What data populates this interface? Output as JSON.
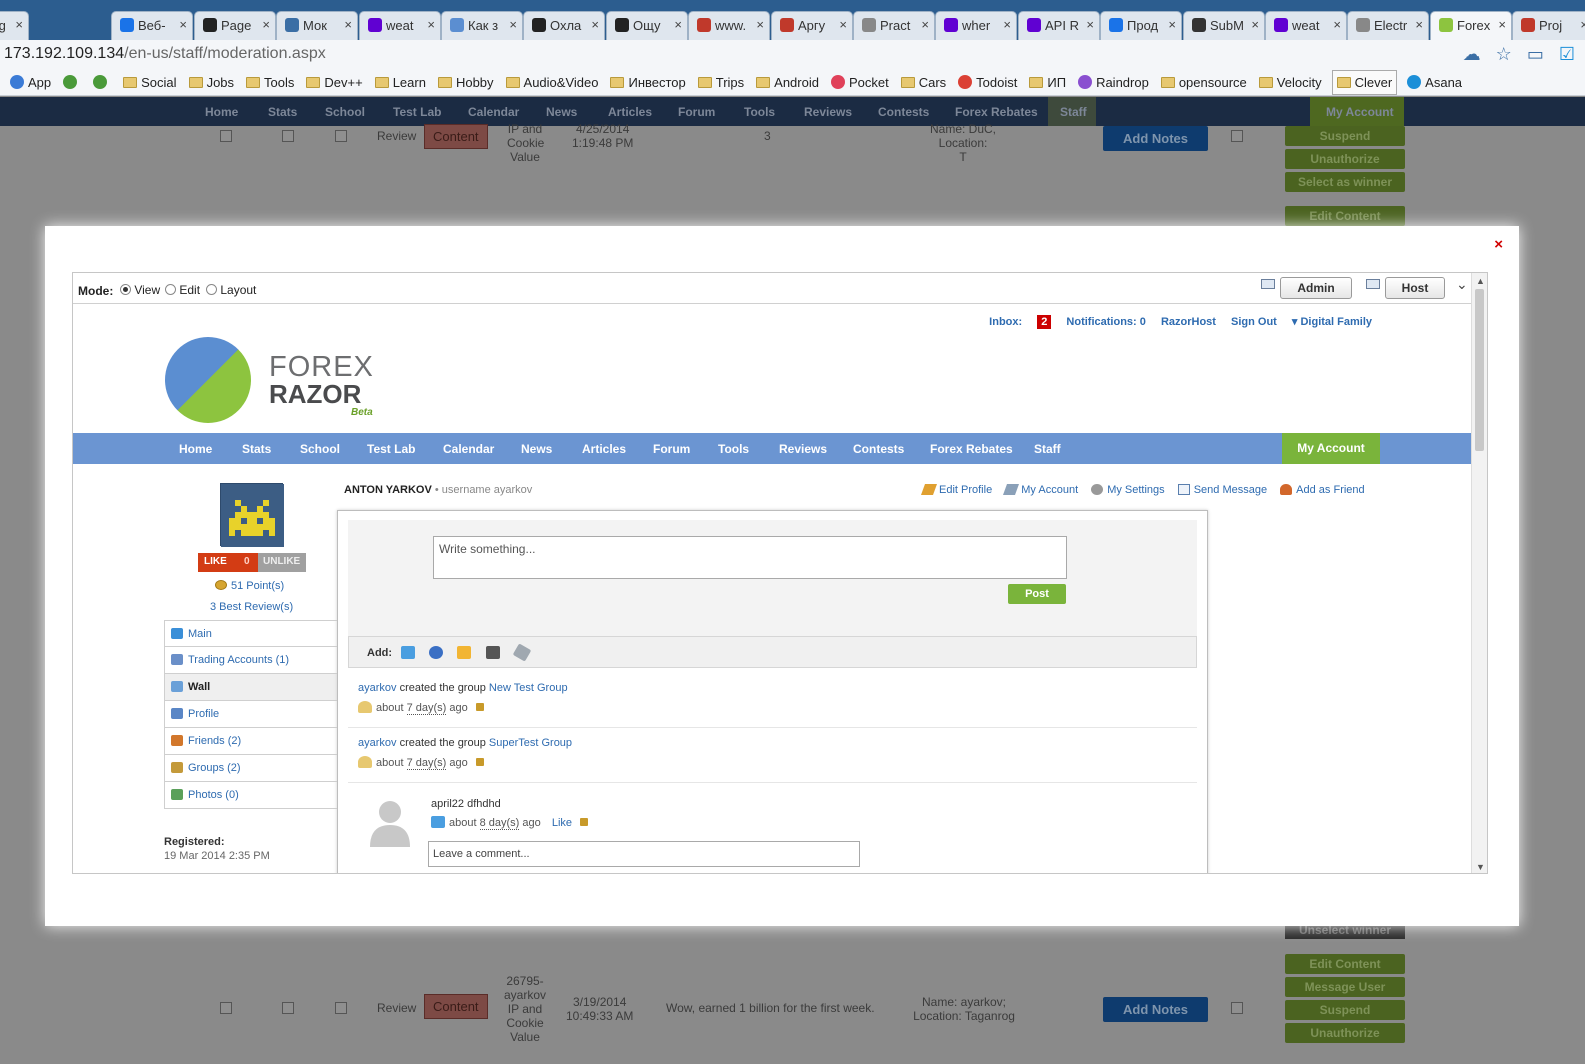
{
  "browser": {
    "tabs": [
      {
        "label": "Goog",
        "color": "#4285f4"
      },
      {
        "label": "Веб-",
        "color": "#1a73e8"
      },
      {
        "label": "Page",
        "color": "#222222"
      },
      {
        "label": "Мок",
        "color": "#3a6ea5"
      },
      {
        "label": "weat",
        "color": "#6001d2"
      },
      {
        "label": "Как з",
        "color": "#5b8ed1"
      },
      {
        "label": "Охла",
        "color": "#222222"
      },
      {
        "label": "Ощу",
        "color": "#222222"
      },
      {
        "label": "www.",
        "color": "#c0392b"
      },
      {
        "label": "Аргу",
        "color": "#c0392b"
      },
      {
        "label": "Pract",
        "color": "#888888"
      },
      {
        "label": "wher",
        "color": "#6001d2"
      },
      {
        "label": "API R",
        "color": "#6001d2"
      },
      {
        "label": "Прод",
        "color": "#1a73e8"
      },
      {
        "label": "SubM",
        "color": "#333333"
      },
      {
        "label": "weat",
        "color": "#6001d2"
      },
      {
        "label": "Electr",
        "color": "#888888"
      },
      {
        "label": "Forex",
        "color": "#8dc43f"
      },
      {
        "label": "Proj",
        "color": "#c0392b"
      }
    ],
    "active_tab_index": 17,
    "close_glyph": "×",
    "url_host": "173.192.109.134",
    "url_path": "/en-us/staff/moderation.aspx",
    "address_icons": [
      "upload-icon",
      "star-icon",
      "folder-icon",
      "badge-icon"
    ],
    "bookmarks": [
      {
        "label": "App",
        "kind": "apps"
      },
      {
        "label": "",
        "kind": "icon"
      },
      {
        "label": "",
        "kind": "icon"
      },
      {
        "label": "Social",
        "kind": "folder"
      },
      {
        "label": "Jobs",
        "kind": "folder"
      },
      {
        "label": "Tools",
        "kind": "folder"
      },
      {
        "label": "Dev++",
        "kind": "folder"
      },
      {
        "label": "Learn",
        "kind": "folder"
      },
      {
        "label": "Hobby",
        "kind": "folder"
      },
      {
        "label": "Audio&Video",
        "kind": "folder"
      },
      {
        "label": "Инвестор",
        "kind": "folder"
      },
      {
        "label": "Trips",
        "kind": "folder"
      },
      {
        "label": "Android",
        "kind": "folder"
      },
      {
        "label": "Pocket",
        "kind": "pocket"
      },
      {
        "label": "Cars",
        "kind": "folder"
      },
      {
        "label": "Todoist",
        "kind": "todoist"
      },
      {
        "label": "ИП",
        "kind": "folder"
      },
      {
        "label": "Raindrop",
        "kind": "raindrop"
      },
      {
        "label": "opensource",
        "kind": "folder"
      },
      {
        "label": "Velocity",
        "kind": "folder"
      },
      {
        "label": "Clever",
        "kind": "folder-boxed"
      },
      {
        "label": "Asana",
        "kind": "asana"
      }
    ]
  },
  "background_page": {
    "nav": [
      "Home",
      "Stats",
      "School",
      "Test Lab",
      "Calendar",
      "News",
      "Articles",
      "Forum",
      "Tools",
      "Reviews",
      "Contests",
      "Forex Rebates",
      "Staff",
      "My Account"
    ],
    "row1": {
      "review": "Review",
      "content": "Content",
      "ip_lines": [
        "IP and",
        "Cookie",
        "Value"
      ],
      "date": "4/25/2014",
      "time": "1:19:48 PM",
      "count": "3",
      "name_line1": "Name: DuC, Location:",
      "name_line2": "T",
      "add_notes": "Add Notes",
      "actions": [
        "Suspend",
        "Unauthorize",
        "Select as winner"
      ],
      "edit_content": "Edit Content"
    },
    "unselect_winner": "Unselect winner",
    "row2": {
      "review": "Review",
      "content": "Content",
      "ip_lines": [
        "26795-",
        "ayarkov",
        "IP and",
        "Cookie",
        "Value"
      ],
      "date": "3/19/2014",
      "time": "10:49:33 AM",
      "message": "Wow, earned 1 billion for the first week.",
      "name_line1": "Name: ayarkov;",
      "name_line2": "Location: Taganrog",
      "add_notes": "Add Notes",
      "actions": [
        "Edit Content",
        "Message User",
        "Suspend",
        "Unauthorize"
      ]
    }
  },
  "modal": {
    "close": "×",
    "mode": {
      "label": "Mode:",
      "options": [
        "View",
        "Edit",
        "Layout"
      ],
      "selected": "View",
      "buttons": [
        "Admin",
        "Host"
      ],
      "collapse": "⌄"
    },
    "toplinks": {
      "inbox_label": "Inbox:",
      "inbox_count": "2",
      "notifications": "Notifications: 0",
      "user": "RazorHost",
      "signout": "Sign Out",
      "family": "▾ Digital Family"
    },
    "logo": {
      "line1": "FOREX",
      "line2": "RAZOR",
      "beta": "Beta"
    },
    "site_nav": [
      "Home",
      "Stats",
      "School",
      "Test Lab",
      "Calendar",
      "News",
      "Articles",
      "Forum",
      "Tools",
      "Reviews",
      "Contests",
      "Forex Rebates",
      "Staff"
    ],
    "site_nav_account": "My Account",
    "profile": {
      "like": "LIKE",
      "like_count": "0",
      "unlike": "UNLIKE",
      "points": "51 Point(s)",
      "best_reviews": "3 Best Review(s)",
      "menu": [
        "Main",
        "Trading Accounts (1)",
        "Wall",
        "Profile",
        "Friends (2)",
        "Groups (2)",
        "Photos (0)"
      ],
      "active_menu": "Wall",
      "registered_label": "Registered:",
      "registered_date": "19 Mar 2014 2:35 PM",
      "name": "ANTON YARKOV",
      "username": "• username ayarkov",
      "links": [
        "Edit Profile",
        "My Account",
        "My Settings",
        "Send Message",
        "Add as Friend"
      ]
    },
    "wall": {
      "placeholder": "Write something...",
      "post": "Post",
      "add_label": "Add:",
      "add_icons": [
        "message-icon",
        "globe-icon",
        "note-icon",
        "camera-icon",
        "attachment-icon"
      ],
      "feed": [
        {
          "user": "ayarkov",
          "action": "created the group",
          "target": "New Test Group",
          "about": "about",
          "ago": "7 day(s)",
          "suffix": "ago"
        },
        {
          "user": "ayarkov",
          "action": "created the group",
          "target": "SuperTest Group",
          "about": "about",
          "ago": "7 day(s)",
          "suffix": "ago"
        }
      ],
      "status": {
        "text": "april22 dfhdhd",
        "about": "about",
        "ago": "8 day(s)",
        "suffix": "ago",
        "like": "Like"
      },
      "comment_placeholder": "Leave a comment..."
    }
  }
}
